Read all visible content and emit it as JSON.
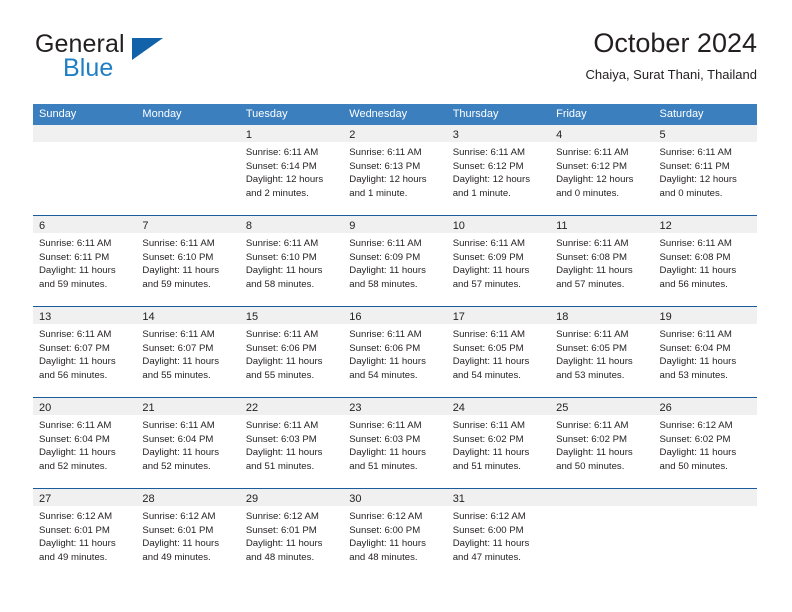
{
  "brand": {
    "name_top": "General",
    "name_bottom": "Blue",
    "triangle_color": "#1162a8",
    "blue_color": "#1f7fc4"
  },
  "header": {
    "title": "October 2024",
    "subtitle": "Chaiya, Surat Thani, Thailand"
  },
  "theme": {
    "header_row_bg": "#3b7fbf",
    "week_divider": "#1a5c9c",
    "day_band_bg": "#f0f0f0",
    "text": "#231f20"
  },
  "weekdays": [
    "Sunday",
    "Monday",
    "Tuesday",
    "Wednesday",
    "Thursday",
    "Friday",
    "Saturday"
  ],
  "weeks": [
    [
      {
        "day": "",
        "sunrise": "",
        "sunset": "",
        "daylight_a": "",
        "daylight_b": ""
      },
      {
        "day": "",
        "sunrise": "",
        "sunset": "",
        "daylight_a": "",
        "daylight_b": ""
      },
      {
        "day": "1",
        "sunrise": "Sunrise: 6:11 AM",
        "sunset": "Sunset: 6:14 PM",
        "daylight_a": "Daylight: 12 hours",
        "daylight_b": "and 2 minutes."
      },
      {
        "day": "2",
        "sunrise": "Sunrise: 6:11 AM",
        "sunset": "Sunset: 6:13 PM",
        "daylight_a": "Daylight: 12 hours",
        "daylight_b": "and 1 minute."
      },
      {
        "day": "3",
        "sunrise": "Sunrise: 6:11 AM",
        "sunset": "Sunset: 6:12 PM",
        "daylight_a": "Daylight: 12 hours",
        "daylight_b": "and 1 minute."
      },
      {
        "day": "4",
        "sunrise": "Sunrise: 6:11 AM",
        "sunset": "Sunset: 6:12 PM",
        "daylight_a": "Daylight: 12 hours",
        "daylight_b": "and 0 minutes."
      },
      {
        "day": "5",
        "sunrise": "Sunrise: 6:11 AM",
        "sunset": "Sunset: 6:11 PM",
        "daylight_a": "Daylight: 12 hours",
        "daylight_b": "and 0 minutes."
      }
    ],
    [
      {
        "day": "6",
        "sunrise": "Sunrise: 6:11 AM",
        "sunset": "Sunset: 6:11 PM",
        "daylight_a": "Daylight: 11 hours",
        "daylight_b": "and 59 minutes."
      },
      {
        "day": "7",
        "sunrise": "Sunrise: 6:11 AM",
        "sunset": "Sunset: 6:10 PM",
        "daylight_a": "Daylight: 11 hours",
        "daylight_b": "and 59 minutes."
      },
      {
        "day": "8",
        "sunrise": "Sunrise: 6:11 AM",
        "sunset": "Sunset: 6:10 PM",
        "daylight_a": "Daylight: 11 hours",
        "daylight_b": "and 58 minutes."
      },
      {
        "day": "9",
        "sunrise": "Sunrise: 6:11 AM",
        "sunset": "Sunset: 6:09 PM",
        "daylight_a": "Daylight: 11 hours",
        "daylight_b": "and 58 minutes."
      },
      {
        "day": "10",
        "sunrise": "Sunrise: 6:11 AM",
        "sunset": "Sunset: 6:09 PM",
        "daylight_a": "Daylight: 11 hours",
        "daylight_b": "and 57 minutes."
      },
      {
        "day": "11",
        "sunrise": "Sunrise: 6:11 AM",
        "sunset": "Sunset: 6:08 PM",
        "daylight_a": "Daylight: 11 hours",
        "daylight_b": "and 57 minutes."
      },
      {
        "day": "12",
        "sunrise": "Sunrise: 6:11 AM",
        "sunset": "Sunset: 6:08 PM",
        "daylight_a": "Daylight: 11 hours",
        "daylight_b": "and 56 minutes."
      }
    ],
    [
      {
        "day": "13",
        "sunrise": "Sunrise: 6:11 AM",
        "sunset": "Sunset: 6:07 PM",
        "daylight_a": "Daylight: 11 hours",
        "daylight_b": "and 56 minutes."
      },
      {
        "day": "14",
        "sunrise": "Sunrise: 6:11 AM",
        "sunset": "Sunset: 6:07 PM",
        "daylight_a": "Daylight: 11 hours",
        "daylight_b": "and 55 minutes."
      },
      {
        "day": "15",
        "sunrise": "Sunrise: 6:11 AM",
        "sunset": "Sunset: 6:06 PM",
        "daylight_a": "Daylight: 11 hours",
        "daylight_b": "and 55 minutes."
      },
      {
        "day": "16",
        "sunrise": "Sunrise: 6:11 AM",
        "sunset": "Sunset: 6:06 PM",
        "daylight_a": "Daylight: 11 hours",
        "daylight_b": "and 54 minutes."
      },
      {
        "day": "17",
        "sunrise": "Sunrise: 6:11 AM",
        "sunset": "Sunset: 6:05 PM",
        "daylight_a": "Daylight: 11 hours",
        "daylight_b": "and 54 minutes."
      },
      {
        "day": "18",
        "sunrise": "Sunrise: 6:11 AM",
        "sunset": "Sunset: 6:05 PM",
        "daylight_a": "Daylight: 11 hours",
        "daylight_b": "and 53 minutes."
      },
      {
        "day": "19",
        "sunrise": "Sunrise: 6:11 AM",
        "sunset": "Sunset: 6:04 PM",
        "daylight_a": "Daylight: 11 hours",
        "daylight_b": "and 53 minutes."
      }
    ],
    [
      {
        "day": "20",
        "sunrise": "Sunrise: 6:11 AM",
        "sunset": "Sunset: 6:04 PM",
        "daylight_a": "Daylight: 11 hours",
        "daylight_b": "and 52 minutes."
      },
      {
        "day": "21",
        "sunrise": "Sunrise: 6:11 AM",
        "sunset": "Sunset: 6:04 PM",
        "daylight_a": "Daylight: 11 hours",
        "daylight_b": "and 52 minutes."
      },
      {
        "day": "22",
        "sunrise": "Sunrise: 6:11 AM",
        "sunset": "Sunset: 6:03 PM",
        "daylight_a": "Daylight: 11 hours",
        "daylight_b": "and 51 minutes."
      },
      {
        "day": "23",
        "sunrise": "Sunrise: 6:11 AM",
        "sunset": "Sunset: 6:03 PM",
        "daylight_a": "Daylight: 11 hours",
        "daylight_b": "and 51 minutes."
      },
      {
        "day": "24",
        "sunrise": "Sunrise: 6:11 AM",
        "sunset": "Sunset: 6:02 PM",
        "daylight_a": "Daylight: 11 hours",
        "daylight_b": "and 51 minutes."
      },
      {
        "day": "25",
        "sunrise": "Sunrise: 6:11 AM",
        "sunset": "Sunset: 6:02 PM",
        "daylight_a": "Daylight: 11 hours",
        "daylight_b": "and 50 minutes."
      },
      {
        "day": "26",
        "sunrise": "Sunrise: 6:12 AM",
        "sunset": "Sunset: 6:02 PM",
        "daylight_a": "Daylight: 11 hours",
        "daylight_b": "and 50 minutes."
      }
    ],
    [
      {
        "day": "27",
        "sunrise": "Sunrise: 6:12 AM",
        "sunset": "Sunset: 6:01 PM",
        "daylight_a": "Daylight: 11 hours",
        "daylight_b": "and 49 minutes."
      },
      {
        "day": "28",
        "sunrise": "Sunrise: 6:12 AM",
        "sunset": "Sunset: 6:01 PM",
        "daylight_a": "Daylight: 11 hours",
        "daylight_b": "and 49 minutes."
      },
      {
        "day": "29",
        "sunrise": "Sunrise: 6:12 AM",
        "sunset": "Sunset: 6:01 PM",
        "daylight_a": "Daylight: 11 hours",
        "daylight_b": "and 48 minutes."
      },
      {
        "day": "30",
        "sunrise": "Sunrise: 6:12 AM",
        "sunset": "Sunset: 6:00 PM",
        "daylight_a": "Daylight: 11 hours",
        "daylight_b": "and 48 minutes."
      },
      {
        "day": "31",
        "sunrise": "Sunrise: 6:12 AM",
        "sunset": "Sunset: 6:00 PM",
        "daylight_a": "Daylight: 11 hours",
        "daylight_b": "and 47 minutes."
      },
      {
        "day": "",
        "sunrise": "",
        "sunset": "",
        "daylight_a": "",
        "daylight_b": ""
      },
      {
        "day": "",
        "sunrise": "",
        "sunset": "",
        "daylight_a": "",
        "daylight_b": ""
      }
    ]
  ]
}
